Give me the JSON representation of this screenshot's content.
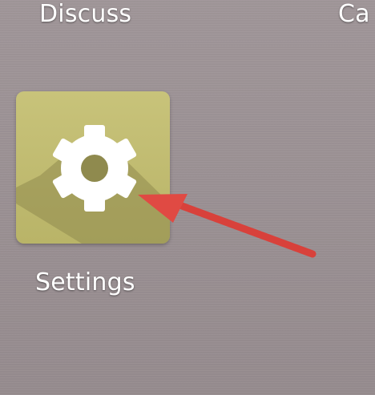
{
  "apps": [
    {
      "label": "Discuss"
    },
    {
      "label": "Ca"
    },
    {
      "label": "Settings",
      "icon": "gear-icon",
      "tile_color": "#c1bd70"
    }
  ],
  "annotation": {
    "type": "arrow",
    "color": "#e04a43"
  }
}
